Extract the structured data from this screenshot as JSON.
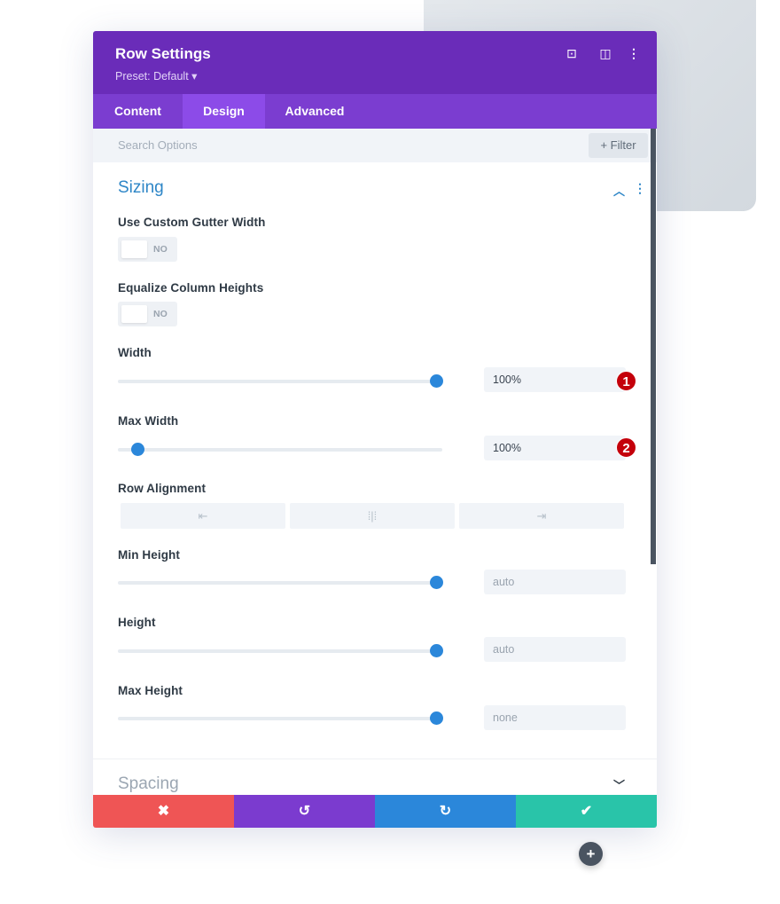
{
  "header": {
    "title": "Row Settings",
    "preset": "Preset: Default ▾",
    "icons": [
      "focus-icon",
      "sidebar-layout-icon",
      "more-vertical-icon"
    ]
  },
  "tabs": [
    {
      "label": "Content"
    },
    {
      "label": "Design",
      "active": true
    },
    {
      "label": "Advanced"
    }
  ],
  "search": {
    "placeholder": "Search Options",
    "filter_label": "+ Filter"
  },
  "sizing": {
    "title": "Sizing",
    "custom_gutter": {
      "label": "Use Custom Gutter Width",
      "value": "NO"
    },
    "equalize": {
      "label": "Equalize Column Heights",
      "value": "NO"
    },
    "width": {
      "label": "Width",
      "value": "100%",
      "slider_percent": 98,
      "badge": "1"
    },
    "max_width": {
      "label": "Max Width",
      "value": "100%",
      "slider_percent": 6,
      "badge": "2"
    },
    "row_alignment": {
      "label": "Row Alignment",
      "options": [
        "⇤",
        "⁞|⁞",
        "⇥"
      ]
    },
    "min_height": {
      "label": "Min Height",
      "placeholder": "auto",
      "slider_percent": 98
    },
    "height": {
      "label": "Height",
      "placeholder": "auto",
      "slider_percent": 98
    },
    "max_height": {
      "label": "Max Height",
      "placeholder": "none",
      "slider_percent": 98
    }
  },
  "spacing": {
    "title": "Spacing"
  },
  "footer": {
    "cancel": "✖",
    "undo": "↺",
    "redo": "↻",
    "save": "✔"
  },
  "add_button": "+",
  "colors": {
    "header": "#6a2cb9",
    "tabs": "#7b3dd0",
    "accent": "#2b87da",
    "cancel": "#ef5555",
    "undo": "#7b3bcf",
    "redo": "#2b87da",
    "save": "#29c4a9"
  }
}
